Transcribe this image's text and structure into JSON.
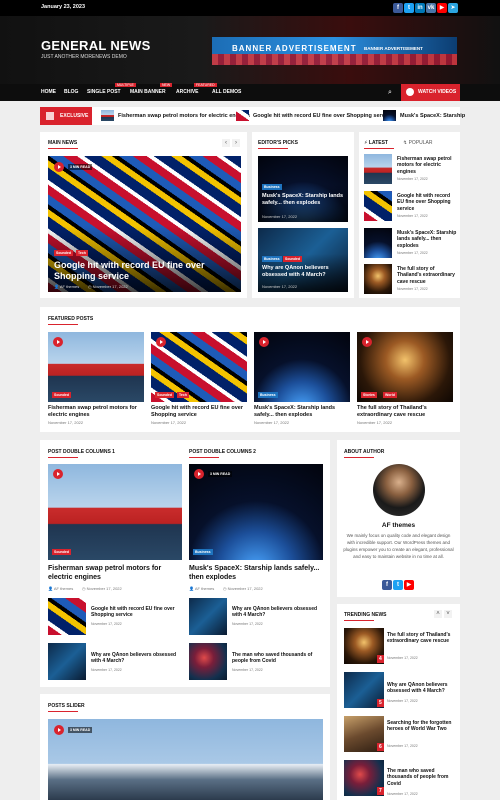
{
  "topbar": {
    "date": "January 23, 2023"
  },
  "social_icons": [
    "facebook-icon",
    "twitter-icon",
    "linkedin-icon",
    "vk-icon",
    "youtube-icon",
    "telegram-icon"
  ],
  "site": {
    "title": "GENERAL NEWS",
    "description": "JUST ANOTHER MORENEWS DEMO"
  },
  "banner": {
    "text": "BANNER ADVERTISEMENT",
    "sub": "BANNER ADVERTISEMENT"
  },
  "nav": {
    "items": [
      "HOME",
      "BLOG",
      "SINGLE POST",
      "MAIN BANNER",
      "ARCHIVE",
      "ALL DEMOS"
    ],
    "tags": [
      "MULTIPLE",
      "NEW",
      "FEATURED"
    ],
    "watch": "WATCH VIDEOS"
  },
  "ticker": {
    "label": "EXCLUSIVE",
    "items": [
      "Fisherman swap petrol motors for electric engines",
      "Google hit with record EU fine over Shopping service",
      "Musk's SpaceX: Starship"
    ]
  },
  "main_news": {
    "heading": "MAIN NEWS",
    "read_badge": "3 MIN READ",
    "cats": [
      "Sounded",
      "Tech"
    ],
    "title": "Google hit with record EU fine over Shopping service",
    "author": "AF themes",
    "date": "November 17, 2022"
  },
  "editors_picks": {
    "heading": "EDITOR'S PICKS",
    "items": [
      {
        "cat": "Business",
        "title": "Musk's SpaceX: Starship lands safely... then explodes",
        "date": "November 17, 2022"
      },
      {
        "cat": "Business",
        "cat2": "Sounded",
        "title": "Why are QAnon believers obsessed with 4 March?",
        "date": "November 17, 2022"
      }
    ]
  },
  "latest": {
    "tabs": [
      "LATEST",
      "POPULAR"
    ],
    "items": [
      {
        "title": "Fisherman swap petrol motors for electric engines",
        "date": "November 17, 2022"
      },
      {
        "title": "Google hit with record EU fine over Shopping service",
        "date": "November 17, 2022"
      },
      {
        "title": "Musk's SpaceX: Starship lands safely... then explodes",
        "date": "November 17, 2022"
      },
      {
        "title": "The full story of Thailand's extraordinary cave rescue",
        "date": "November 17, 2022"
      }
    ]
  },
  "featured": {
    "heading": "FEATURED POSTS",
    "items": [
      {
        "cat": "Sounded",
        "title": "Fisherman swap petrol motors for electric engines",
        "date": "November 17, 2022"
      },
      {
        "cat": "Sounded",
        "cat2": "Tech",
        "title": "Google hit with record EU fine over Shopping service",
        "date": "November 17, 2022"
      },
      {
        "cat": "Business",
        "title": "Musk's SpaceX: Starship lands safely... then explodes",
        "date": "November 17, 2022"
      },
      {
        "cat": "Stories",
        "cat2": "World",
        "title": "The full story of Thailand's extraordinary cave rescue",
        "date": "November 17, 2022"
      }
    ]
  },
  "double_columns": {
    "col1": {
      "heading": "POST DOUBLE COLUMNS 1",
      "cat": "Sounded",
      "title": "Fisherman swap petrol motors for electric engines",
      "author": "AF themes",
      "date": "November 17, 2022",
      "list": [
        {
          "title": "Google hit with record EU fine over Shopping service",
          "date": "November 17, 2022"
        },
        {
          "title": "Why are QAnon believers obsessed with 4 March?",
          "date": "November 17, 2022"
        }
      ]
    },
    "col2": {
      "heading": "POST DOUBLE COLUMNS 2",
      "read_badge": "3 MIN READ",
      "cat": "Business",
      "title": "Musk's SpaceX: Starship lands safely... then explodes",
      "author": "AF themes",
      "date": "November 17, 2022",
      "list": [
        {
          "title": "Why are QAnon believers obsessed with 4 March?",
          "date": "November 17, 2022"
        },
        {
          "title": "The man who saved thousands of people from Covid",
          "date": "November 17, 2022"
        }
      ]
    }
  },
  "about": {
    "heading": "ABOUT AUTHOR",
    "name": "AF themes",
    "bio": "We mainly focus on quality code and elegant design with incredible support. Our WordPress themes and plugins empower you to create an elegant, professional and easy to maintain website in no time at all."
  },
  "trending": {
    "heading": "TRENDING NEWS",
    "items": [
      {
        "num": "4",
        "title": "The full story of Thailand's extraordinary cave rescue",
        "date": "November 17, 2022"
      },
      {
        "num": "5",
        "title": "Why are QAnon believers obsessed with 4 March?",
        "date": "November 17, 2022"
      },
      {
        "num": "6",
        "title": "Searching for the forgotten heroes of World War Two",
        "date": "November 17, 2022"
      },
      {
        "num": "7",
        "title": "The man who saved thousands of people from Covid",
        "date": "November 17, 2022"
      }
    ]
  },
  "slider": {
    "heading": "POSTS SLIDER",
    "read_badge": "3 MIN READ"
  },
  "colors": {
    "accent": "#d9232d",
    "business": "#1e73be",
    "dark": "#0d0d0d"
  }
}
